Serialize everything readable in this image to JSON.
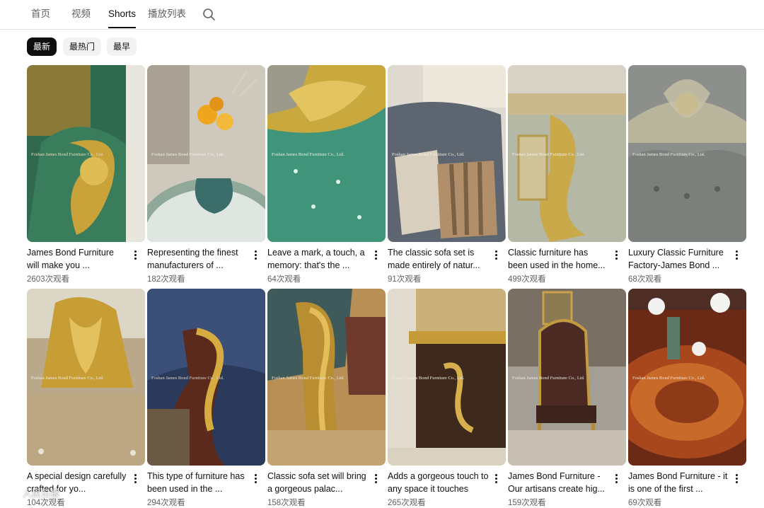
{
  "tabs": [
    {
      "label": "首页"
    },
    {
      "label": "视频"
    },
    {
      "label": "Shorts"
    },
    {
      "label": "播放列表"
    }
  ],
  "chips": [
    {
      "label": "最新"
    },
    {
      "label": "最热门"
    },
    {
      "label": "最早"
    }
  ],
  "shorts": [
    {
      "title": "James Bond Furniture will make you ...",
      "views": "2603次观看",
      "thumb_overlay": "Foshan James Bond Furniture Co., Ltd."
    },
    {
      "title": "Representing the finest manufacturers of ...",
      "views": "182次观看",
      "thumb_overlay": "Foshan James Bond Furniture Co., Ltd."
    },
    {
      "title": "Leave a mark, a touch, a memory: that's the ...",
      "views": "64次观看",
      "thumb_overlay": "Foshan James Bond Furniture Co., Ltd."
    },
    {
      "title": "The classic sofa set is made entirely of natur...",
      "views": "91次观看",
      "thumb_overlay": "Foshan James Bond Furniture Co., Ltd."
    },
    {
      "title": "Classic furniture has been used in the home...",
      "views": "499次观看",
      "thumb_overlay": "Foshan James Bond Furniture Co., Ltd."
    },
    {
      "title": "Luxury Classic Furniture Factory-James Bond ...",
      "views": "68次观看",
      "thumb_overlay": "Foshan James Bond Furniture Co., Ltd."
    },
    {
      "title": "A special design carefully crafted for yo...",
      "views": "104次观看",
      "thumb_overlay": "Foshan James Bond Furniture Co., Ltd."
    },
    {
      "title": "This type of furniture has been used in the ...",
      "views": "294次观看",
      "thumb_overlay": "Foshan James Bond Furniture Co., Ltd."
    },
    {
      "title": "Classic sofa set will bring a gorgeous palac...",
      "views": "158次观看",
      "thumb_overlay": "Foshan James Bond Furniture Co., Ltd."
    },
    {
      "title": "Adds a gorgeous touch to any space it touches",
      "views": "265次观看",
      "thumb_overlay": "Foshan James Bond Furniture Co., Ltd."
    },
    {
      "title": "James Bond Furniture - Our artisans create hig...",
      "views": "159次观看",
      "thumb_overlay": "Foshan James Bond Furniture Co., Ltd."
    },
    {
      "title": "James Bond Furniture - it is one of the first ...",
      "views": "69次观看",
      "thumb_overlay": "Foshan James Bond Furniture Co., Ltd."
    }
  ],
  "watermark": {
    "text": "人民日报"
  },
  "colors": {
    "active_chip_bg": "#0f0f0f",
    "chip_bg": "#f2f2f2",
    "secondary_text": "#606060"
  },
  "icons": {
    "search": "search-icon",
    "more": "more-vert-icon"
  }
}
